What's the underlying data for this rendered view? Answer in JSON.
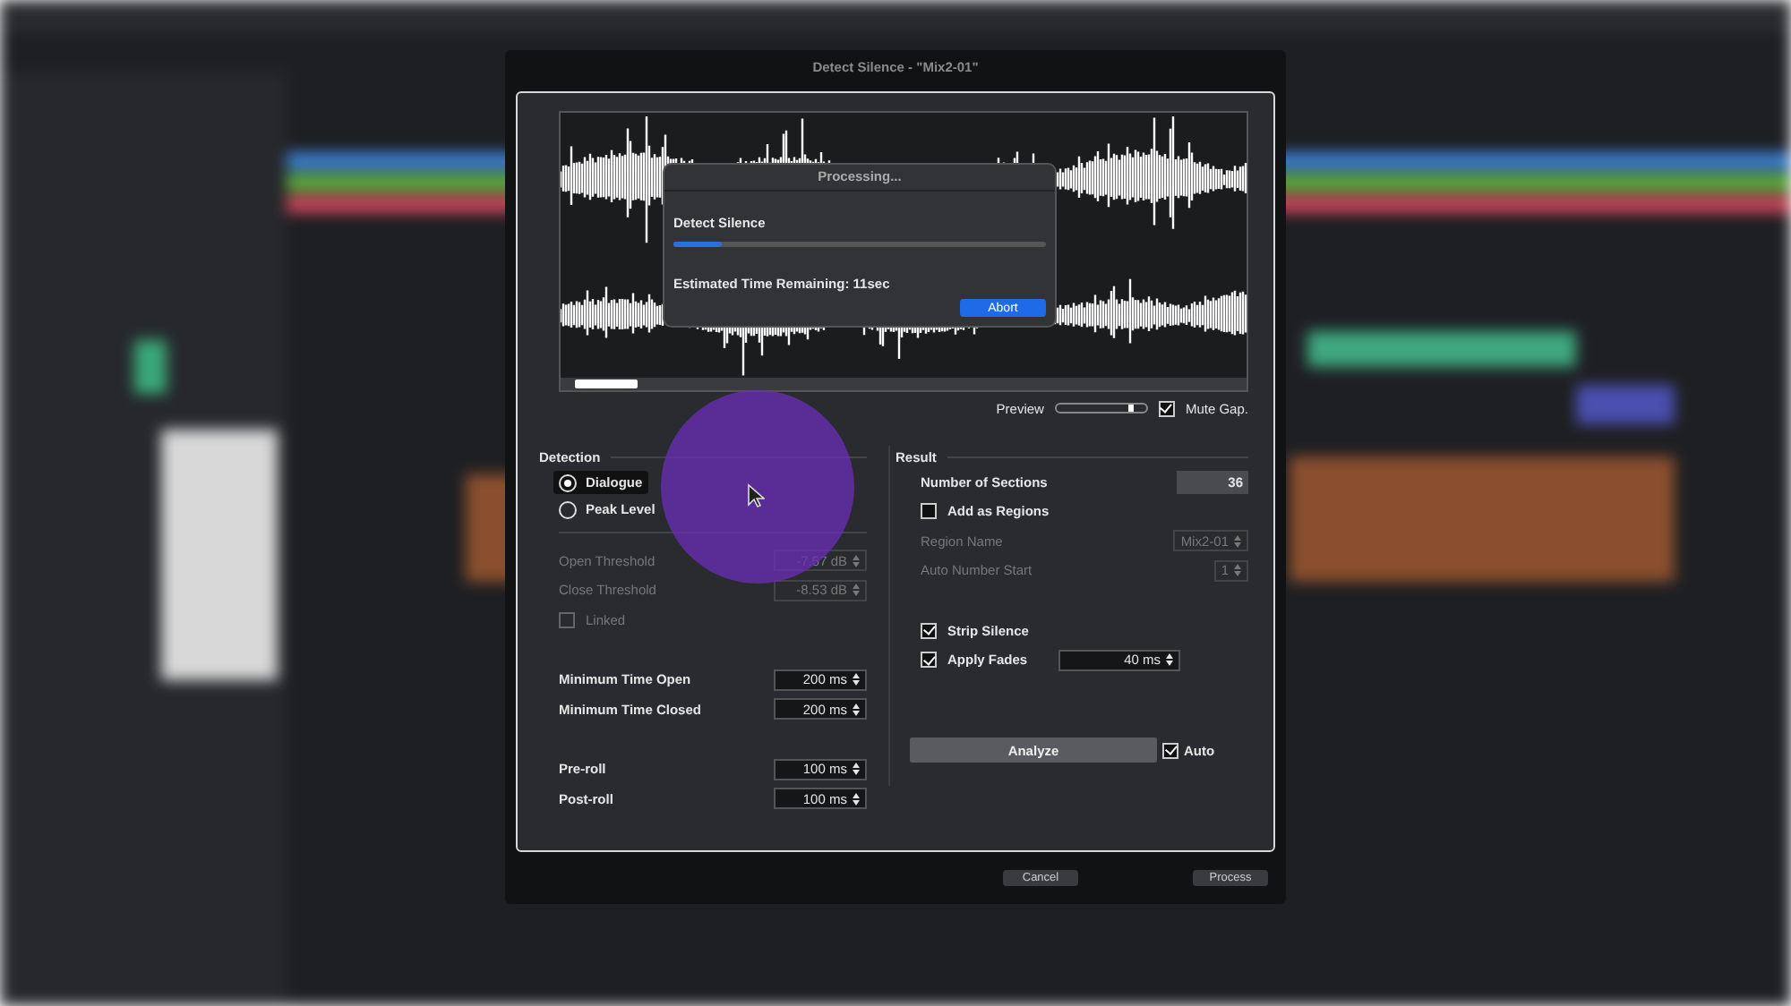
{
  "window": {
    "title": "Detect Silence - \"Mix2-01\""
  },
  "preview": {
    "label": "Preview",
    "level": 0.8
  },
  "mute_gap": {
    "label": "Mute Gap.",
    "checked": true
  },
  "processing": {
    "title": "Processing...",
    "task": "Detect Silence",
    "level": 0.13,
    "remaining": "Estimated Time Remaining: 11sec",
    "button": "Abort"
  },
  "detection": {
    "heading": "Detection",
    "modes": [
      {
        "label": "Dialogue",
        "selected": true
      },
      {
        "label": "Peak Level",
        "selected": false
      }
    ],
    "groups": [
      [
        {
          "kind": "field",
          "label": "Open Threshold",
          "value": "-7.57 dB",
          "disabled": true
        },
        {
          "kind": "field",
          "label": "Close Threshold",
          "value": "-8.53 dB",
          "disabled": true
        },
        {
          "kind": "check",
          "label": "Linked",
          "checked": false,
          "disabled": true
        }
      ],
      [
        {
          "kind": "field",
          "label": "Minimum Time Open",
          "value": "200 ms",
          "disabled": false
        },
        {
          "kind": "field",
          "label": "Minimum Time Closed",
          "value": "200 ms",
          "disabled": false
        }
      ],
      [
        {
          "kind": "field",
          "label": "Pre-roll",
          "value": "100 ms",
          "disabled": false
        },
        {
          "kind": "field",
          "label": "Post-roll",
          "value": "100 ms",
          "disabled": false
        }
      ]
    ]
  },
  "result": {
    "heading": "Result",
    "groups": [
      [
        {
          "kind": "readout",
          "label": "Number of Sections",
          "value": "36"
        },
        {
          "kind": "check",
          "label": "Add as Regions",
          "checked": false
        },
        {
          "kind": "field",
          "label": "Region Name",
          "value": "Mix2-01",
          "disabled": true
        },
        {
          "kind": "field",
          "label": "Auto Number Start",
          "value": "1",
          "disabled": true
        }
      ],
      [
        {
          "kind": "check",
          "label": "Strip Silence",
          "checked": true
        },
        {
          "kind": "checkfield",
          "label": "Apply Fades",
          "checked": true,
          "value": "40 ms"
        }
      ]
    ],
    "analyze": "Analyze",
    "auto": {
      "label": "Auto",
      "checked": true
    }
  },
  "buttons": [
    "Cancel",
    "Process"
  ]
}
